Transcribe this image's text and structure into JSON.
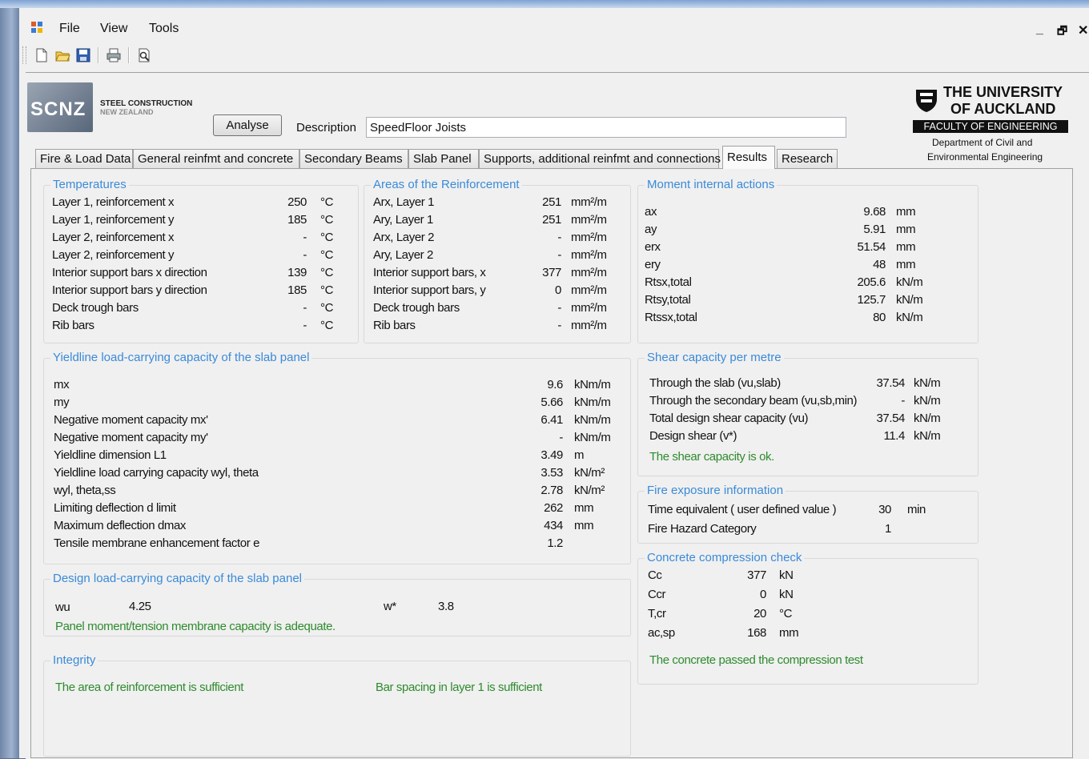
{
  "menu": {
    "file": "File",
    "view": "View",
    "tools": "Tools"
  },
  "window_controls": {
    "minimize": "_",
    "restore": "🗗",
    "close": "✕"
  },
  "toolbar_icons": [
    "new-icon",
    "open-icon",
    "save-icon",
    "print-icon",
    "print-preview-icon"
  ],
  "logo": {
    "scnz": "SCNZ",
    "line1": "STEEL CONSTRUCTION",
    "line2": "NEW ZEALAND"
  },
  "analyse_label": "Analyse",
  "description": {
    "label": "Description",
    "value": "SpeedFloor Joists"
  },
  "uoa": {
    "line1": "THE UNIVERSITY",
    "line2": "OF AUCKLAND",
    "faculty": "FACULTY OF ENGINEERING",
    "dept1": "Department of Civil and",
    "dept2": "Environmental Engineering"
  },
  "tabs": [
    "Fire & Load Data",
    "General reinfmt and concrete",
    "Secondary Beams",
    "Slab Panel",
    "Supports, additional reinfmt and connections",
    "Results",
    "Research"
  ],
  "temperatures": {
    "title": "Temperatures",
    "rows": [
      {
        "label": "Layer 1, reinforcement x",
        "value": "250",
        "unit": "°C"
      },
      {
        "label": "Layer 1, reinforcement y",
        "value": "185",
        "unit": "°C"
      },
      {
        "label": "Layer 2, reinforcement x",
        "value": "-",
        "unit": "°C"
      },
      {
        "label": "Layer 2, reinforcement y",
        "value": "-",
        "unit": "°C"
      },
      {
        "label": "Interior support bars x direction",
        "value": "139",
        "unit": "°C"
      },
      {
        "label": "Interior support bars y direction",
        "value": "185",
        "unit": "°C"
      },
      {
        "label": "Deck trough bars",
        "value": "-",
        "unit": "°C"
      },
      {
        "label": "Rib bars",
        "value": "-",
        "unit": "°C"
      }
    ]
  },
  "areas": {
    "title": "Areas of the Reinforcement",
    "rows": [
      {
        "label": "Arx, Layer 1",
        "value": "251",
        "unit": "mm²/m"
      },
      {
        "label": "Ary, Layer 1",
        "value": "251",
        "unit": "mm²/m"
      },
      {
        "label": "Arx, Layer 2",
        "value": "-",
        "unit": "mm²/m"
      },
      {
        "label": "Ary, Layer 2",
        "value": "-",
        "unit": "mm²/m"
      },
      {
        "label": "Interior support bars, x",
        "value": "377",
        "unit": "mm²/m"
      },
      {
        "label": "Interior support bars, y",
        "value": "0",
        "unit": "mm²/m"
      },
      {
        "label": "Deck trough bars",
        "value": "-",
        "unit": "mm²/m"
      },
      {
        "label": "Rib bars",
        "value": "-",
        "unit": "mm²/m"
      }
    ]
  },
  "moment": {
    "title": "Moment internal actions",
    "rows": [
      {
        "label": "ax",
        "value": "9.68",
        "unit": "mm"
      },
      {
        "label": "ay",
        "value": "5.91",
        "unit": "mm"
      },
      {
        "label": "erx",
        "value": "51.54",
        "unit": "mm"
      },
      {
        "label": "ery",
        "value": "48",
        "unit": "mm"
      },
      {
        "label": "Rtsx,total",
        "value": "205.6",
        "unit": "kN/m"
      },
      {
        "label": "Rtsy,total",
        "value": "125.7",
        "unit": "kN/m"
      },
      {
        "label": "Rtssx,total",
        "value": "80",
        "unit": "kN/m"
      }
    ]
  },
  "yieldline": {
    "title": "Yieldline load-carrying capacity of the slab panel",
    "rows": [
      {
        "label": "mx",
        "value": "9.6",
        "unit": "kNm/m"
      },
      {
        "label": "my",
        "value": "5.66",
        "unit": "kNm/m"
      },
      {
        "label": "Negative moment capacity mx'",
        "value": "6.41",
        "unit": "kNm/m"
      },
      {
        "label": "Negative moment capacity my'",
        "value": "-",
        "unit": "kNm/m"
      },
      {
        "label": "Yieldline dimension L1",
        "value": "3.49",
        "unit": "m"
      },
      {
        "label": "Yieldline load carrying capacity  wyl, theta",
        "value": "3.53",
        "unit": "kN/m²"
      },
      {
        "label": "wyl, theta,ss",
        "value": "2.78",
        "unit": "kN/m²"
      },
      {
        "label": "Limiting deflection d limit",
        "value": "262",
        "unit": "mm"
      },
      {
        "label": "Maximum deflection dmax",
        "value": "434",
        "unit": "mm"
      },
      {
        "label": "Tensile membrane enhancement factor e",
        "value": "1.2",
        "unit": ""
      }
    ]
  },
  "shear": {
    "title": "Shear capacity per metre",
    "rows": [
      {
        "label": "Through the slab (vu,slab)",
        "value": "37.54",
        "unit": "kN/m"
      },
      {
        "label": "Through the secondary beam (vu,sb,min)",
        "value": "-",
        "unit": "kN/m"
      },
      {
        "label": "Total design shear capacity (vu)",
        "value": "37.54",
        "unit": "kN/m"
      },
      {
        "label": "Design shear (v*)",
        "value": "11.4",
        "unit": "kN/m"
      }
    ],
    "status": "The shear capacity is ok."
  },
  "fire": {
    "title": "Fire exposure information",
    "rows": [
      {
        "label": "Time equivalent ( user defined value )",
        "value": "30",
        "unit": "min"
      },
      {
        "label": "Fire Hazard Category",
        "value": "1",
        "unit": ""
      }
    ]
  },
  "design": {
    "title": "Design load-carrying capacity of the slab panel",
    "wu_label": "wu",
    "wu_value": "4.25",
    "wstar_label": "w*",
    "wstar_value": "3.8",
    "status": "Panel moment/tension membrane capacity is adequate."
  },
  "concrete": {
    "title": "Concrete compression check",
    "rows": [
      {
        "label": "Cc",
        "value": "377",
        "unit": "kN"
      },
      {
        "label": "Ccr",
        "value": "0",
        "unit": "kN"
      },
      {
        "label": "T,cr",
        "value": "20",
        "unit": "°C"
      },
      {
        "label": "ac,sp",
        "value": "168",
        "unit": "mm"
      }
    ],
    "status": "The concrete passed the compression test"
  },
  "integrity": {
    "title": "Integrity",
    "msg1": "The area of reinforcement is sufficient",
    "msg2": "Bar spacing in layer 1 is sufficient"
  }
}
